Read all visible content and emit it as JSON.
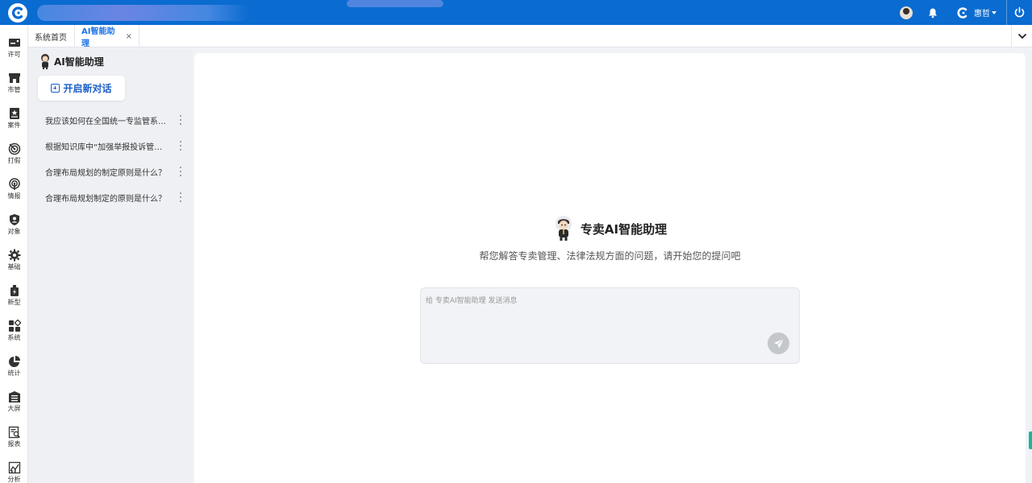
{
  "topbar": {
    "user_name": "惠哲",
    "accent": "#0a6bd0"
  },
  "rail": {
    "items": [
      {
        "label": "许可",
        "icon": "license-icon"
      },
      {
        "label": "市管",
        "icon": "store-icon"
      },
      {
        "label": "案件",
        "icon": "case-icon"
      },
      {
        "label": "打假",
        "icon": "target-icon"
      },
      {
        "label": "情报",
        "icon": "broadcast-icon"
      },
      {
        "label": "对象",
        "icon": "user-shield-icon"
      },
      {
        "label": "基础",
        "icon": "gear-icon"
      },
      {
        "label": "新型",
        "icon": "bolt-icon"
      },
      {
        "label": "系统",
        "icon": "grid-icon"
      },
      {
        "label": "统计",
        "icon": "pie-icon"
      },
      {
        "label": "大屏",
        "icon": "screen-icon"
      },
      {
        "label": "报表",
        "icon": "report-search-icon"
      },
      {
        "label": "分析",
        "icon": "analysis-chart-icon"
      }
    ]
  },
  "tabs": [
    {
      "label": "系统首页",
      "active": false
    },
    {
      "label": "AI智能助理",
      "active": true,
      "close": "×"
    }
  ],
  "sidebar": {
    "title": "AI智能助理",
    "new_chat_label": "开启新对话",
    "conversations": [
      {
        "title": "我应该如何在全国统一专监管系统中"
      },
      {
        "title": "根据知识库中“加强举报投诉管理”"
      },
      {
        "title": "合理布局规划的制定原则是什么？"
      },
      {
        "title": "合理布局规划制定的原则是什么？"
      }
    ]
  },
  "main": {
    "title": "专卖AI智能助理",
    "subtitle": "帮您解答专卖管理、法律法规方面的问题，请开始您的提问吧",
    "input_placeholder": "给 专卖AI智能助理 发送消息",
    "input_value": ""
  }
}
